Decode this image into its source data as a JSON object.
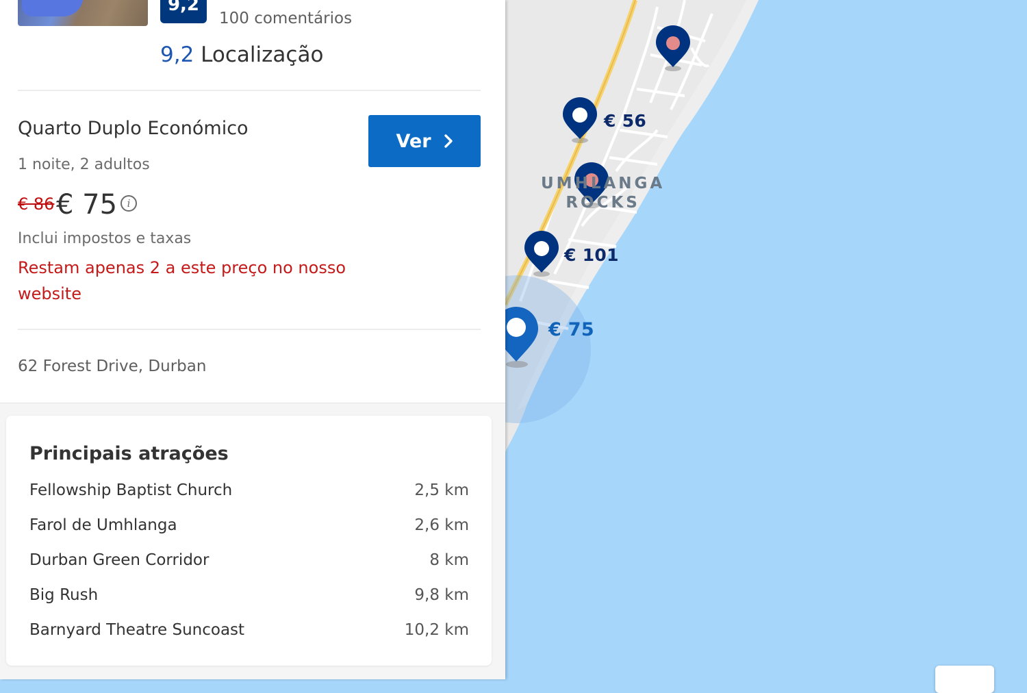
{
  "hotel": {
    "score": "9,2",
    "reviews": "100 comentários",
    "location_score": "9,2",
    "location_label": "Localização"
  },
  "room": {
    "title": "Quarto Duplo Económico",
    "details": "1 noite, 2 adultos",
    "view_button": "Ver",
    "old_price": "€ 86",
    "price": "€ 75",
    "taxes_note": "Inclui impostos e taxas",
    "scarcity": "Restam apenas 2 a este preço no nosso website",
    "address": "62 Forest Drive, Durban"
  },
  "attractions": {
    "title": "Principais atrações",
    "items": [
      {
        "name": "Fellowship Baptist Church",
        "distance": "2,5 km"
      },
      {
        "name": "Farol de Umhlanga",
        "distance": "2,6 km"
      },
      {
        "name": "Durban Green Corridor",
        "distance": "8 km"
      },
      {
        "name": "Big Rush",
        "distance": "9,8 km"
      },
      {
        "name": "Barnyard Theatre Suncoast",
        "distance": "10,2 km"
      }
    ]
  },
  "map": {
    "area_label_line1": "UMHLANGA",
    "area_label_line2": "ROCKS",
    "pins": [
      {
        "price": "€ 56"
      },
      {
        "price": "€ 101"
      },
      {
        "price": "€ 75",
        "selected": true
      }
    ],
    "colors": {
      "sea": "#a7d6fb",
      "land": "#e8e8e8",
      "pin": "#00337f",
      "selected_pin": "#1465c0"
    }
  }
}
